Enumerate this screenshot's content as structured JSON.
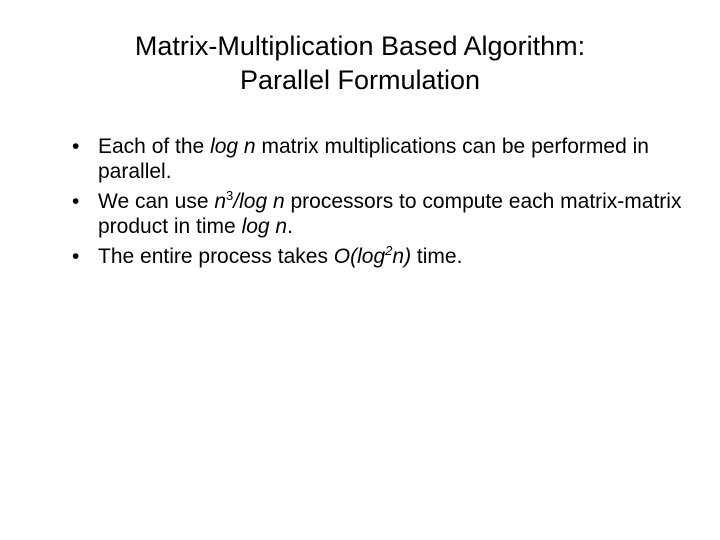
{
  "title_line1": "Matrix-Multiplication Based Algorithm:",
  "title_line2": "Parallel Formulation",
  "bullets": {
    "b1": {
      "t1": "Each of the ",
      "logn": "log n",
      "t2": " matrix multiplications can be performed in parallel."
    },
    "b2": {
      "t1": "We can use ",
      "n": "n",
      "sup3": "3",
      "t2": "/",
      "logn": "log n",
      "t3": " processors to compute each matrix-matrix product in time ",
      "logn2": "log n",
      "t4": "."
    },
    "b3": {
      "t1": "The entire process takes ",
      "O": "O(log",
      "sup2": "2",
      "n": "n)",
      "t2": " time."
    }
  }
}
